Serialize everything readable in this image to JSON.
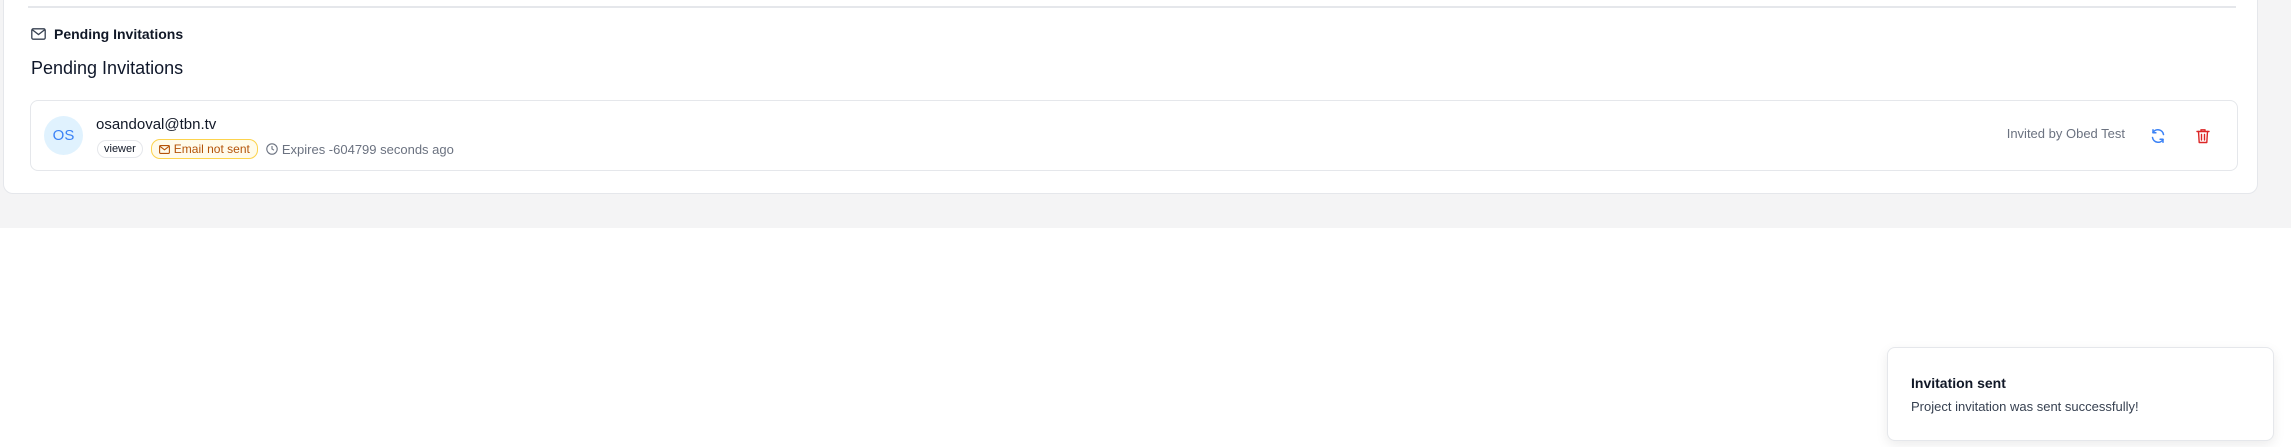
{
  "section": {
    "header_label": "Pending Invitations",
    "title": "Pending Invitations"
  },
  "invitations": [
    {
      "initials": "OS",
      "email": "osandoval@tbn.tv",
      "role": "viewer",
      "email_status": "Email not sent",
      "expires": "Expires -604799 seconds ago",
      "invited_by": "Invited by Obed Test",
      "icons": {
        "status": "mail-icon",
        "expires": "clock-icon",
        "resend": "refresh-icon",
        "delete": "trash-icon"
      }
    }
  ],
  "toast": {
    "title": "Invitation sent",
    "message": "Project invitation was sent successfully!"
  },
  "colors": {
    "accent_blue": "#3b82f6",
    "danger_red": "#dc2626",
    "warning_amber": "#b45309",
    "avatar_bg": "#e0f2fe"
  }
}
